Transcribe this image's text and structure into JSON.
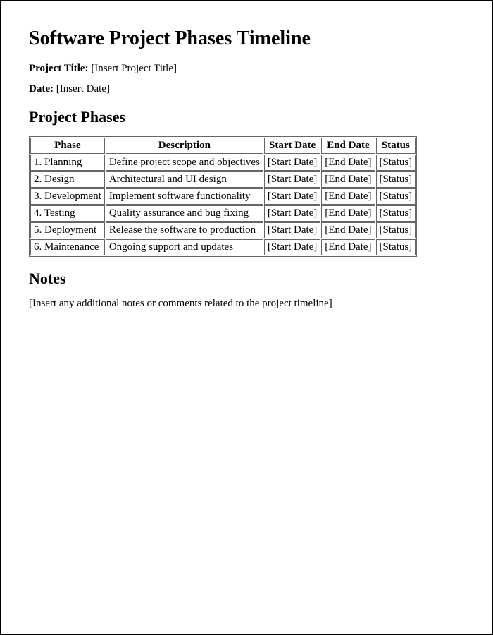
{
  "title": "Software Project Phases Timeline",
  "projectTitle": {
    "label": "Project Title:",
    "value": "[Insert Project Title]"
  },
  "date": {
    "label": "Date:",
    "value": "[Insert Date]"
  },
  "phasesHeading": "Project Phases",
  "table": {
    "headers": {
      "phase": "Phase",
      "description": "Description",
      "startDate": "Start Date",
      "endDate": "End Date",
      "status": "Status"
    },
    "rows": [
      {
        "phase": "1. Planning",
        "description": "Define project scope and objectives",
        "startDate": "[Start Date]",
        "endDate": "[End Date]",
        "status": "[Status]"
      },
      {
        "phase": "2. Design",
        "description": "Architectural and UI design",
        "startDate": "[Start Date]",
        "endDate": "[End Date]",
        "status": "[Status]"
      },
      {
        "phase": "3. Development",
        "description": "Implement software functionality",
        "startDate": "[Start Date]",
        "endDate": "[End Date]",
        "status": "[Status]"
      },
      {
        "phase": "4. Testing",
        "description": "Quality assurance and bug fixing",
        "startDate": "[Start Date]",
        "endDate": "[End Date]",
        "status": "[Status]"
      },
      {
        "phase": "5. Deployment",
        "description": "Release the software to production",
        "startDate": "[Start Date]",
        "endDate": "[End Date]",
        "status": "[Status]"
      },
      {
        "phase": "6. Maintenance",
        "description": "Ongoing support and updates",
        "startDate": "[Start Date]",
        "endDate": "[End Date]",
        "status": "[Status]"
      }
    ]
  },
  "notesHeading": "Notes",
  "notesBody": "[Insert any additional notes or comments related to the project timeline]"
}
